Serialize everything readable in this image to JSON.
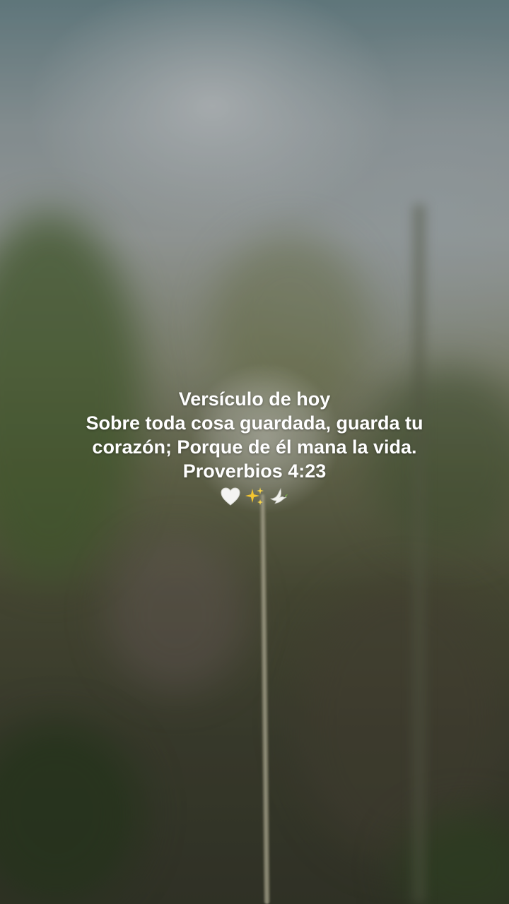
{
  "caption": {
    "heading": "Versículo de hoy",
    "line1": "Sobre toda cosa guardada, guarda tu",
    "line2": "corazón; Porque de él mana la vida.",
    "reference": "Proverbios 4:23",
    "emojis": [
      "white-heart-icon",
      "sparkles-icon",
      "dove-icon"
    ]
  },
  "colors": {
    "text": "#ffffff",
    "sky": "#9aa6aa",
    "foliage": "#4d4f38"
  }
}
